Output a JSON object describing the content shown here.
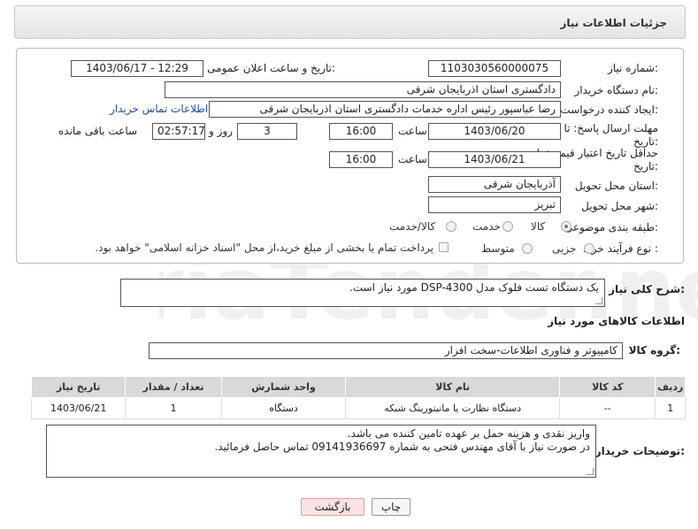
{
  "header": {
    "title": "جزئیات اطلاعات نیاز"
  },
  "form": {
    "need_number_label": "شماره نیاز:",
    "need_number": "1103030560000075",
    "announce_label": "تاریخ و ساعت اعلان عمومی:",
    "announce_value": "1403/06/17 - 12:29",
    "buyer_org_label": "نام دستگاه خریدار:",
    "buyer_org": "دادگستری استان اذربایجان شرقی",
    "requester_label": "ایجاد کننده درخواست:",
    "requester": "رضا عباسپور رئیس اداره خدمات دادگستری استان اذربایجان شرقی",
    "contact_link": "اطلاعات تماس خریدار",
    "deadline_label_1": "مهلت ارسال پاسخ: تا",
    "deadline_label_2": "تاریخ:",
    "deadline_date": "1403/06/20",
    "time_label": "ساعت",
    "deadline_time": "16:00",
    "days_value": "3",
    "days_label": "روز و",
    "remaining_time": "02:57:17",
    "remaining_label": "ساعت باقی مانده",
    "min_validity_label_1": "حداقل تاریخ اعتبار قیمت: تا",
    "min_validity_label_2": "تاریخ:",
    "validity_date": "1403/06/21",
    "validity_time": "16:00",
    "province_label": "استان محل تحویل:",
    "province": "آذربایجان شرقی",
    "city_label": "شهر محل تحویل:",
    "city": "تبریز",
    "category_label": "طبقه بندی موضوعی:",
    "category_options": [
      "کالا",
      "خدمت",
      "کالا/خدمت"
    ],
    "process_label": "نوع فرآیند خرید :",
    "process_options": [
      "جزیی",
      "متوسط"
    ],
    "payment_note": "پرداخت تمام یا بخشی از مبلغ خرید،از محل \"اسناد خزانه اسلامی\" خواهد بود."
  },
  "description": {
    "label": "شرح کلی نیاز:",
    "text": "یک دستگاه تست فلوک مدل DSP-4300  مورد نیاز است."
  },
  "goods": {
    "section_title": "اطلاعات کالاهای مورد نیاز",
    "group_label": "گروه کالا:",
    "group_value": "کامپیوتر و فناوری اطلاعات-سخت افزار",
    "columns": [
      "ردیف",
      "کد کالا",
      "نام کالا",
      "واحد شمارش",
      "تعداد / مقدار",
      "تاریخ نیاز"
    ],
    "rows": [
      [
        "1",
        "--",
        "دستگاه نظارت یا مانیتورینگ شبکه",
        "دستگاه",
        "1",
        "1403/06/21"
      ]
    ]
  },
  "buyer_notes": {
    "label": "توضیحات خریدار:",
    "line1": "واریز نقدی و هزینه حمل بر عهده تامین کننده می باشد.",
    "line2": "در صورت نیاز با آقای مهندس فتحی به شماره 09141936697 تماس حاصل فرمائید."
  },
  "buttons": {
    "print": "چاپ",
    "back": "بازگشت"
  },
  "colors": {
    "link": "#1a4da8",
    "back_bg": "#fbe3e3"
  },
  "watermark_text": "AriaTender.neT"
}
